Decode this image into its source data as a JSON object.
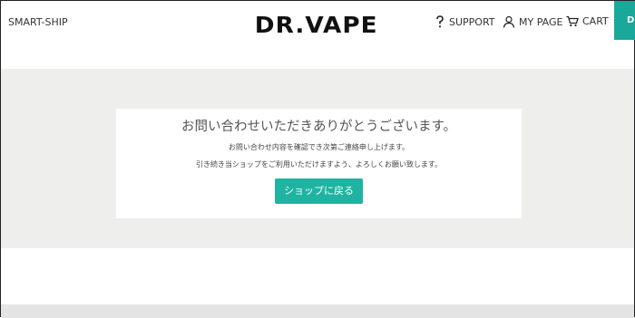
{
  "header": {
    "left_link": "SMART-SHIP",
    "logo": "DR.VAPE",
    "nav": [
      {
        "label": "SUPPORT",
        "icon": "question-icon"
      },
      {
        "label": "MY PAGE",
        "icon": "user-icon"
      },
      {
        "label": "CART",
        "icon": "cart-icon"
      }
    ],
    "right_button": "DI"
  },
  "card": {
    "title": "お問い合わせいただきありがとうございます。",
    "line1": "お問い合わせ内容を確認でき次第ご連絡申し上げます。",
    "line2": "引き続き当ショップをご利用いただけますよう、よろしくお願い致します。",
    "button": "ショップに戻る"
  },
  "colors": {
    "accent": "#1fb3a2",
    "band": "#eeeeec"
  }
}
